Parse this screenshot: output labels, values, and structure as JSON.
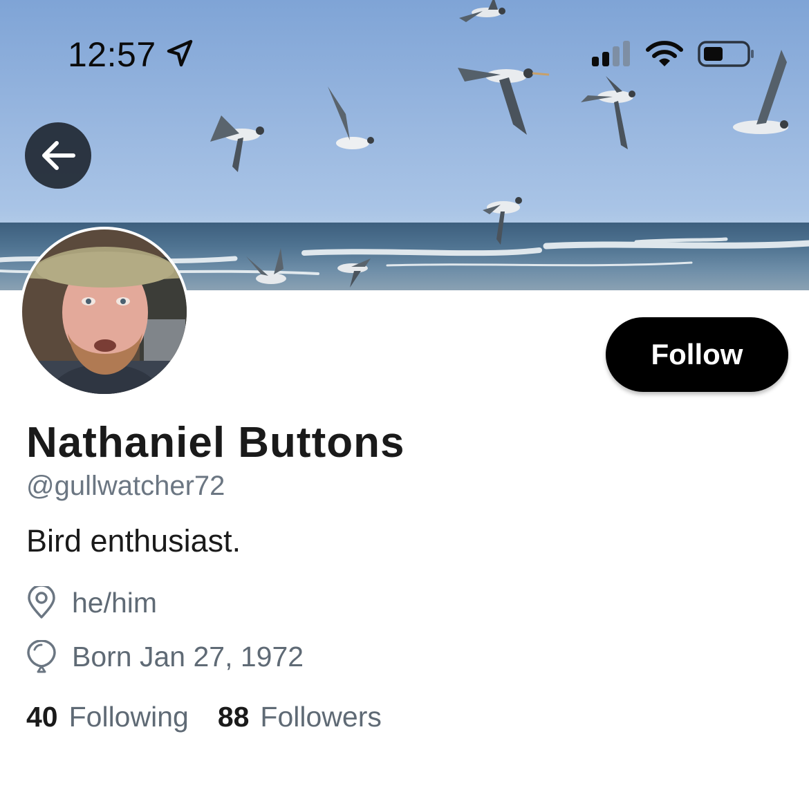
{
  "status_bar": {
    "time": "12:57",
    "location_icon": "location-arrow-icon",
    "signal_icon": "cellular-signal-icon",
    "wifi_icon": "wifi-icon",
    "battery_icon": "battery-icon",
    "battery_level": 0.4
  },
  "header": {
    "banner": "gulls-over-ocean",
    "back_icon": "arrow-left-icon"
  },
  "profile": {
    "avatar": "avatar",
    "follow_label": "Follow",
    "display_name": "Nathaniel Buttons",
    "handle": "@gullwatcher72",
    "bio": "Bird enthusiast.",
    "pronouns_icon": "location-pin-icon",
    "pronouns": "he/him",
    "birthday_icon": "balloon-icon",
    "birthday": "Born Jan 27, 1972"
  },
  "stats": {
    "following_count": "40",
    "following_label": "Following",
    "followers_count": "88",
    "followers_label": "Followers"
  },
  "colors": {
    "follow_button_bg": "#000000",
    "secondary_text": "#5f6a75",
    "primary_text": "#1a1a1a"
  }
}
